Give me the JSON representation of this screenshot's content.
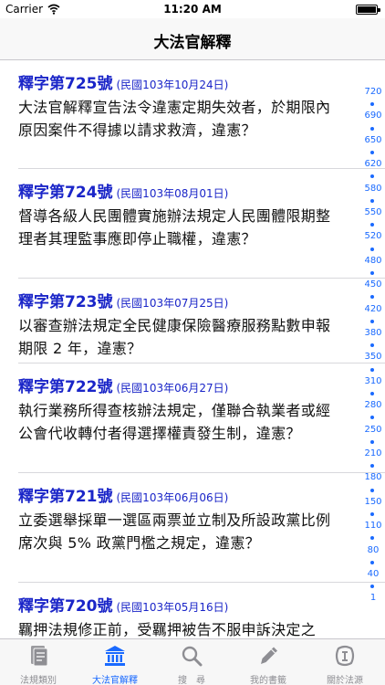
{
  "status_bar": {
    "carrier": "Carrier",
    "time": "11:20 AM"
  },
  "nav": {
    "title": "大法官解釋"
  },
  "items": [
    {
      "number": "釋字第725號",
      "date": "(民國103年10月24日)",
      "text": "大法官解釋宣告法令違憲定期失效者，於期限內原因案件不得據以請求救濟，違憲？"
    },
    {
      "number": "釋字第724號",
      "date": "(民國103年08月01日)",
      "text": "督導各級人民團體實施辦法規定人民團體限期整理者其理監事應即停止職權，違憲？"
    },
    {
      "number": "釋字第723號",
      "date": "(民國103年07月25日)",
      "text": "以審查辦法規定全民健康保險醫療服務點數申報期限 2 年，違憲？"
    },
    {
      "number": "釋字第722號",
      "date": "(民國103年06月27日)",
      "text": "執行業務所得查核辦法規定，僅聯合執業者或經公會代收轉付者得選擇權責發生制，違憲？"
    },
    {
      "number": "釋字第721號",
      "date": "(民國103年06月06日)",
      "text": "立委選舉採單一選區兩票並立制及所設政黨比例席次與 5% 政黨門檻之規定，違憲？"
    },
    {
      "number": "釋字第720號",
      "date": "(民國103年05月16日)",
      "text": "羈押法規修正前，受羈押被告不服申訴決定之"
    }
  ],
  "index": [
    "720",
    "690",
    "650",
    "620",
    "580",
    "550",
    "520",
    "480",
    "450",
    "420",
    "380",
    "350",
    "310",
    "280",
    "250",
    "210",
    "180",
    "150",
    "110",
    "80",
    "40",
    "1"
  ],
  "tabs": [
    {
      "label": "法規類別",
      "icon": "document-icon",
      "active": false
    },
    {
      "label": "大法官解釋",
      "icon": "courthouse-icon",
      "active": true
    },
    {
      "label": "搜　尋",
      "icon": "search-icon",
      "active": false
    },
    {
      "label": "我的書籤",
      "icon": "pencil-icon",
      "active": false
    },
    {
      "label": "關於法源",
      "icon": "logo-icon",
      "active": false
    }
  ],
  "colors": {
    "accent": "#1a6aff",
    "number": "#1a25c8"
  }
}
